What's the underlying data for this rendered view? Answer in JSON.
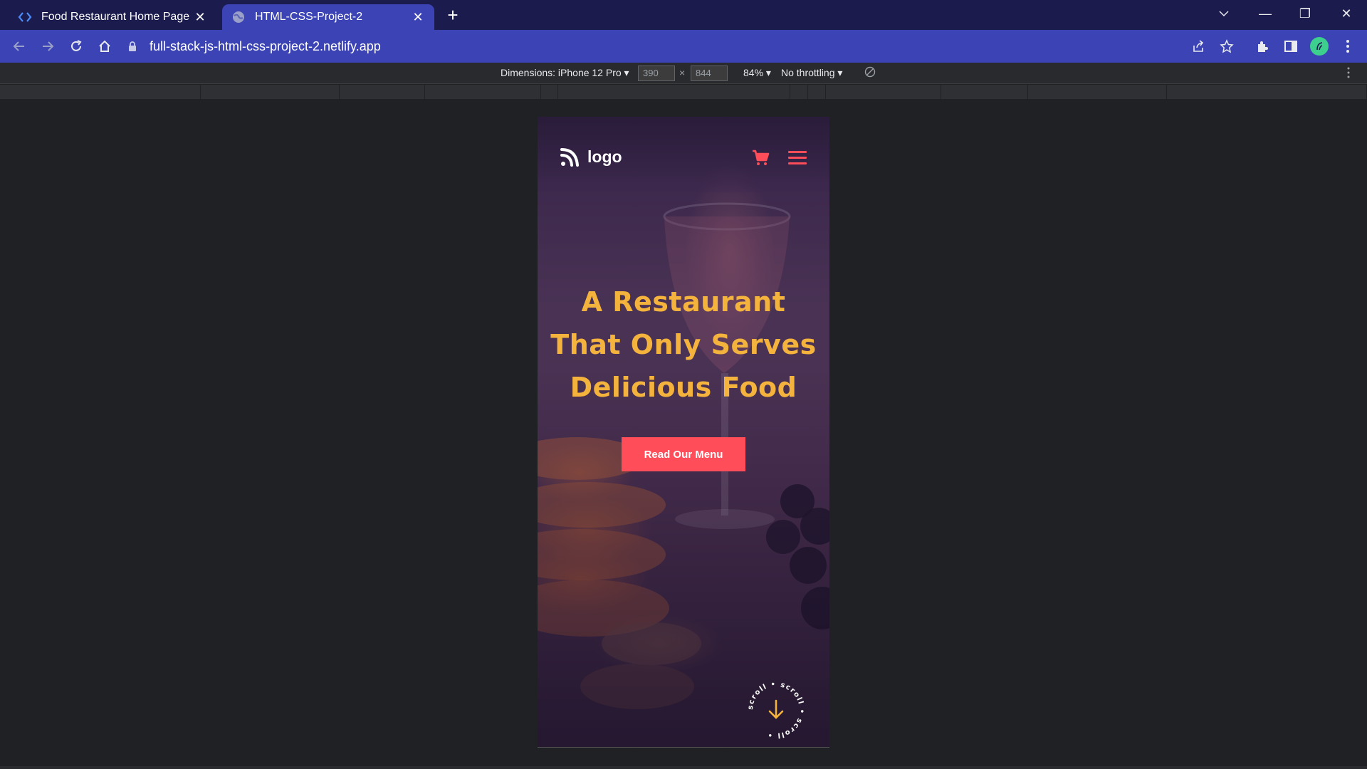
{
  "browser": {
    "tabs": [
      {
        "title": "Food Restaurant Home Page",
        "active": false,
        "icon": "code-brackets-icon"
      },
      {
        "title": "HTML-CSS-Project-2",
        "active": true,
        "icon": "globe-icon"
      }
    ],
    "new_tab": "+",
    "url": "full-stack-js-html-css-project-2.netlify.app",
    "window_controls": {
      "minimize": "—",
      "restore": "❐",
      "close": "✕"
    },
    "colors": {
      "titlebar": "#1b1c4d",
      "toolbar": "#3b43b5"
    }
  },
  "devtools": {
    "dimensions_label": "Dimensions: iPhone 12 Pro",
    "width": "390",
    "times": "×",
    "height": "844",
    "zoom": "84%",
    "throttling": "No throttling"
  },
  "site": {
    "logo_text": "logo",
    "hero_lines": [
      "A Restaurant",
      "That Only Serves",
      "Delicious Food"
    ],
    "cta_label": "Read Our Menu",
    "scroll_text": "scroll • scroll • scroll •",
    "colors": {
      "accent": "#ff4d5a",
      "headline": "#f4b33c"
    }
  }
}
